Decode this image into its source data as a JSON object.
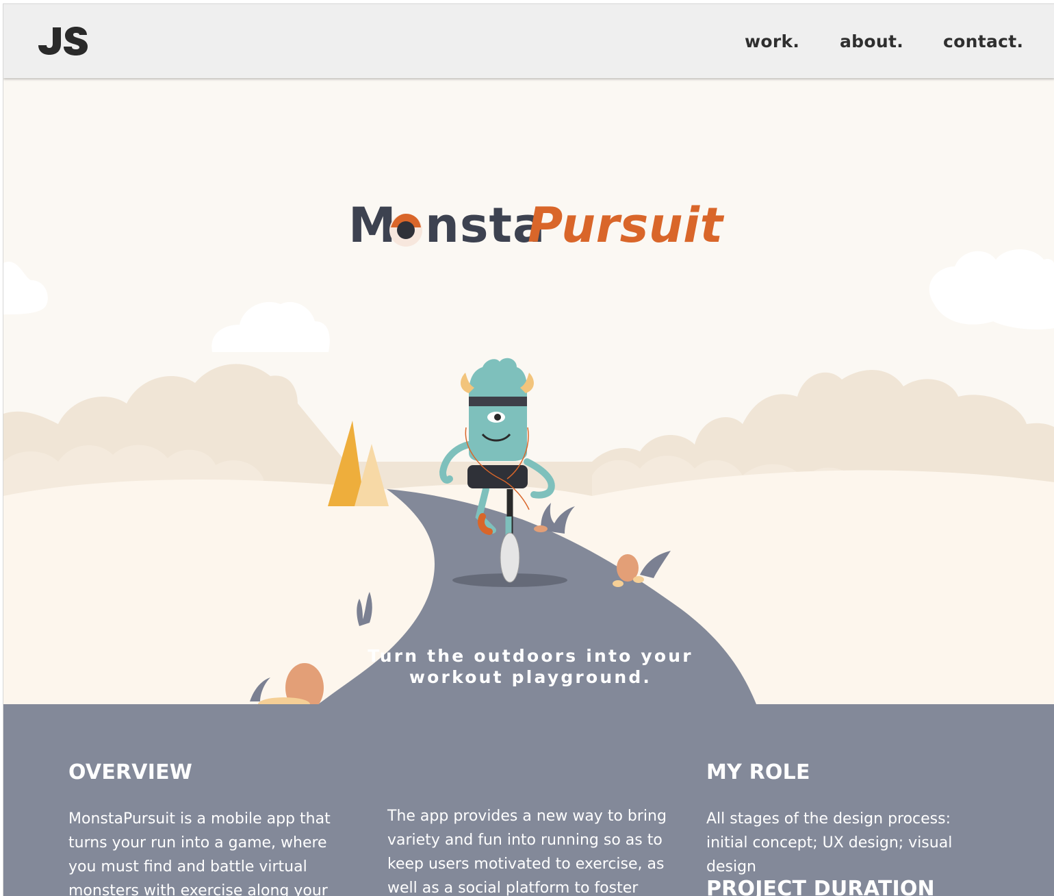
{
  "nav": {
    "logo_text": "JS",
    "links": [
      "work.",
      "about.",
      "contact."
    ]
  },
  "hero": {
    "brand_part1": "M",
    "brand_part2": "nsta",
    "brand_part3": "Pursuit",
    "tagline_line1": "Turn the outdoors into your",
    "tagline_line2": "workout playground."
  },
  "content": {
    "overview_heading": "OVERVIEW",
    "overview_text": "MonstaPursuit is a mobile app that turns your run into a game, where you must find and battle virtual monsters with exercise along your route.",
    "middle_text": "The app provides a new way to bring variety and fun into running so as to keep users motivated to exercise, as well as a social platform to foster local",
    "role_heading": "MY ROLE",
    "role_text": "All stages of the design process: initial concept; UX design; visual design",
    "duration_heading": "PROJECT DURATION"
  },
  "colors": {
    "nav_bg": "#efefef",
    "hero_bg": "#fbf8f3",
    "path": "#838999",
    "brand_dark": "#3d4250",
    "brand_orange": "#d9662a",
    "monster": "#7ec0bc"
  },
  "icons": [
    "js-logo-icon",
    "monster-eye-icon",
    "monster-illustration"
  ]
}
